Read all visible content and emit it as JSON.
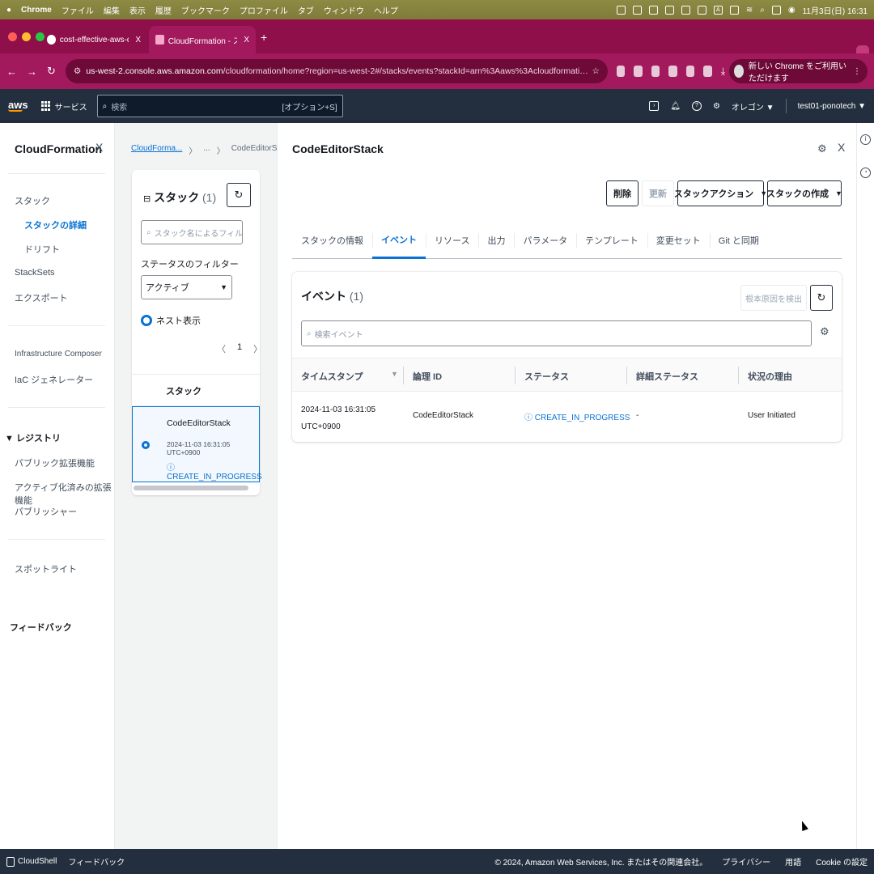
{
  "macbar": {
    "app": "Chrome",
    "menus": [
      "ファイル",
      "編集",
      "表示",
      "履歴",
      "ブックマーク",
      "プロファイル",
      "タブ",
      "ウィンドウ",
      "ヘルプ"
    ],
    "input_indicator": "A",
    "datetime": "11月3日(日) 16:31"
  },
  "browser": {
    "tabs": [
      {
        "title": "cost-effective-aws-deployme",
        "close": "X"
      },
      {
        "title": "CloudFormation - スタック Co",
        "close": "X"
      }
    ],
    "new_tab": "+",
    "url_host": "us-west-2.console.aws.amazon.com",
    "url_path": "/cloudformation/home?region=us-west-2#/stacks/events?stackId=arn%3Aaws%3Acloudformation%3Aus-west-2%3A20593061563...",
    "new_chrome_label": "新しい Chrome をご利用いただけます",
    "traffic_colors": [
      "#ff5f57",
      "#febc2e",
      "#28c840"
    ]
  },
  "awsbar": {
    "logo": "aws",
    "services": "サービス",
    "search_placeholder": "検索",
    "search_shortcut": "[オプション+S]",
    "region": "オレゴン ▼",
    "account": "test01-ponotech ▼"
  },
  "leftnav": {
    "title": "CloudFormation",
    "close": "X",
    "items": [
      {
        "label": "スタック"
      },
      {
        "label": "スタックの詳細"
      },
      {
        "label": "ドリフト"
      },
      {
        "label": "StackSets"
      },
      {
        "label": "エクスポート"
      },
      {
        "label": "Infrastructure Composer"
      },
      {
        "label": "IaC ジェネレーター"
      },
      {
        "label": "▼ レジストリ"
      },
      {
        "label": "パブリック拡張機能"
      },
      {
        "label": "アクティブ化済みの拡張機能"
      },
      {
        "label": "パブリッシャー"
      },
      {
        "label": "スポットライト"
      },
      {
        "label": "フィードバック"
      }
    ]
  },
  "stackpane": {
    "breadcrumb": {
      "root": "CloudForma...",
      "sep": "〉",
      "ellipsis": "...",
      "current": "CodeEditorStack"
    },
    "heading": "スタック",
    "count": "(1)",
    "filter_placeholder": "スタック名によるフィルター",
    "status_filter_label": "ステータスのフィルター",
    "status_filter_value": "アクティブ",
    "nested_label": "ネスト表示",
    "page": "1",
    "column_header": "スタック",
    "row": {
      "name": "CodeEditorStack",
      "timestamp": "2024-11-03 16:31:05 UTC+0900",
      "status": "CREATE_IN_PROGRESS"
    }
  },
  "main": {
    "stack_title": "CodeEditorStack",
    "buttons": {
      "delete": "削除",
      "update": "更新",
      "stack_actions": "スタックアクション",
      "create_stack": "スタックの作成"
    },
    "tabs": [
      "スタックの情報",
      "イベント",
      "リソース",
      "出力",
      "パラメータ",
      "テンプレート",
      "変更セット",
      "Git と同期"
    ],
    "events": {
      "heading": "イベント",
      "count": "(1)",
      "root_cause_button": "根本原因を検出",
      "search_placeholder": "検索イベント",
      "columns": [
        "タイムスタンプ",
        "論理 ID",
        "ステータス",
        "詳細ステータス",
        "状況の理由"
      ],
      "rows": [
        {
          "timestamp_date": "2024-11-03 16:31:05",
          "timestamp_tz": "UTC+0900",
          "logical_id": "CodeEditorStack",
          "status": "CREATE_IN_PROGRESS",
          "detail_status": "-",
          "reason": "User Initiated"
        }
      ]
    }
  },
  "footer": {
    "cloudshell": "CloudShell",
    "feedback": "フィードバック",
    "copyright": "© 2024, Amazon Web Services, Inc. またはその関連会社。",
    "privacy": "プライバシー",
    "terms": "用語",
    "cookie": "Cookie の設定"
  }
}
